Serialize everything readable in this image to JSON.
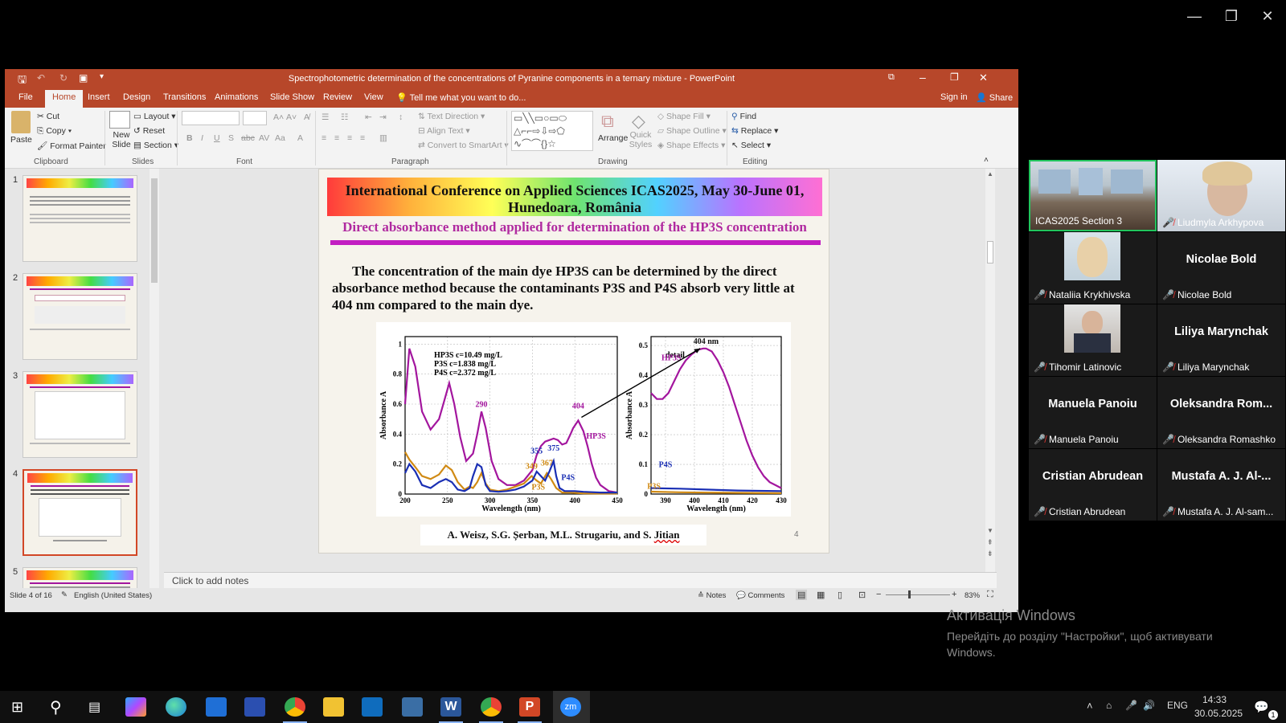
{
  "outer": {
    "minimize": "—",
    "restore": "❐",
    "close": "✕"
  },
  "ppt": {
    "title": "Spectrophotometric determination of the concentrations of Pyranine components in a ternary mixture - PowerPoint",
    "tabs": [
      "File",
      "Home",
      "Insert",
      "Design",
      "Transitions",
      "Animations",
      "Slide Show",
      "Review",
      "View"
    ],
    "tell_me": "Tell me what you want to do...",
    "sign_in": "Sign in",
    "share": "Share",
    "ribbon": {
      "paste": "Paste",
      "cut": "Cut",
      "copy": "Copy",
      "format_painter": "Format Painter",
      "clipboard": "Clipboard",
      "new_slide": "New Slide",
      "layout": "Layout",
      "reset": "Reset",
      "section": "Section",
      "slides": "Slides",
      "font": "Font",
      "paragraph": "Paragraph",
      "text_direction": "Text Direction",
      "align_text": "Align Text",
      "convert_smartart": "Convert to SmartArt",
      "arrange": "Arrange",
      "quick_styles": "Quick Styles",
      "shape_fill": "Shape Fill",
      "shape_outline": "Shape Outline",
      "shape_effects": "Shape Effects",
      "drawing": "Drawing",
      "find": "Find",
      "replace": "Replace",
      "select": "Select",
      "editing": "Editing"
    },
    "thumb_numbers": [
      "1",
      "2",
      "3",
      "4",
      "5"
    ],
    "slide": {
      "header": "International Conference on Applied Sciences ICAS2025, May 30-June 01, Hunedoara, România",
      "subtitle": "Direct absorbance method applied for determination of the HP3S concentration",
      "body": "The concentration of the main dye HP3S can be determined by the direct absorbance method because the contaminants P3S and P4S absorb very little at 404 nm compared to the main dye.",
      "authors": "A. Weisz, S.G. Șerban, M.L. Strugariu, and S. ",
      "authors_last": "Jitian",
      "number": "4"
    },
    "notes_placeholder": "Click to add notes",
    "status": {
      "slide": "Slide 4 of 16",
      "language": "English (United States)",
      "notes": "Notes",
      "comments": "Comments",
      "zoom": "83%"
    }
  },
  "chart_data": [
    {
      "type": "line",
      "xlabel": "Wavelength (nm)",
      "ylabel": "Absorbance A",
      "xlim": [
        200,
        450
      ],
      "ylim": [
        0,
        1.05
      ],
      "xticks": [
        "200",
        "250",
        "300",
        "350",
        "400",
        "450"
      ],
      "yticks": [
        "0",
        "0.2",
        "0.4",
        "0.6",
        "0.8",
        "1"
      ],
      "legend": [
        "HP3S c=10.49 mg/L",
        "P3S    c=1.838 mg/L",
        "P4S    c=2.372 mg/L"
      ],
      "annotations": [
        "290",
        "355",
        "375",
        "404",
        "349",
        "367",
        "HP3S",
        "P3S",
        "P4S"
      ],
      "series": [
        {
          "name": "HP3S",
          "color": "#a3169e",
          "x": [
            200,
            205,
            212,
            220,
            230,
            240,
            246,
            252,
            258,
            265,
            272,
            280,
            285,
            290,
            295,
            302,
            310,
            320,
            330,
            340,
            350,
            355,
            360,
            365,
            370,
            375,
            380,
            385,
            390,
            395,
            398,
            404,
            410,
            415,
            420,
            425,
            430,
            440,
            450
          ],
          "y": [
            0.6,
            0.97,
            0.85,
            0.55,
            0.43,
            0.5,
            0.62,
            0.74,
            0.6,
            0.38,
            0.22,
            0.27,
            0.4,
            0.55,
            0.44,
            0.22,
            0.1,
            0.06,
            0.06,
            0.09,
            0.16,
            0.26,
            0.32,
            0.35,
            0.36,
            0.37,
            0.36,
            0.33,
            0.34,
            0.4,
            0.44,
            0.49,
            0.42,
            0.32,
            0.2,
            0.11,
            0.06,
            0.02,
            0.01
          ]
        },
        {
          "name": "P3S",
          "color": "#d08a14",
          "x": [
            200,
            205,
            212,
            220,
            230,
            240,
            248,
            255,
            262,
            270,
            276,
            280,
            285,
            290,
            295,
            300,
            310,
            320,
            330,
            340,
            349,
            355,
            360,
            367,
            372,
            378,
            385,
            395,
            410,
            430,
            450
          ],
          "y": [
            0.28,
            0.23,
            0.18,
            0.12,
            0.1,
            0.13,
            0.19,
            0.16,
            0.08,
            0.03,
            0.05,
            0.04,
            0.08,
            0.14,
            0.07,
            0.03,
            0.02,
            0.03,
            0.05,
            0.07,
            0.12,
            0.09,
            0.07,
            0.14,
            0.1,
            0.04,
            0.01,
            0.01,
            0.005,
            0.003,
            0.003
          ]
        },
        {
          "name": "P4S",
          "color": "#1a2fb4",
          "x": [
            200,
            205,
            212,
            220,
            230,
            240,
            248,
            255,
            262,
            270,
            276,
            280,
            285,
            290,
            295,
            300,
            310,
            320,
            330,
            340,
            350,
            355,
            360,
            365,
            370,
            375,
            378,
            382,
            388,
            395,
            400,
            410,
            430,
            450
          ],
          "y": [
            0.14,
            0.2,
            0.15,
            0.06,
            0.04,
            0.08,
            0.1,
            0.08,
            0.03,
            0.02,
            0.04,
            0.12,
            0.2,
            0.18,
            0.06,
            0.02,
            0.015,
            0.02,
            0.03,
            0.05,
            0.09,
            0.15,
            0.12,
            0.09,
            0.15,
            0.22,
            0.12,
            0.04,
            0.02,
            0.02,
            0.02,
            0.015,
            0.01,
            0.01
          ]
        }
      ]
    },
    {
      "type": "line",
      "title": "detail",
      "xlabel": "Wavelength (nm)",
      "ylabel": "Absorbance A",
      "xlim": [
        385,
        430
      ],
      "ylim": [
        0,
        0.53
      ],
      "xticks": [
        "390",
        "400",
        "410",
        "420",
        "430"
      ],
      "yticks": [
        "0",
        "0.1",
        "0.2",
        "0.3",
        "0.4",
        "0.5"
      ],
      "annotations": [
        "404 nm",
        "HP3S",
        "P4S",
        "P3S"
      ],
      "series": [
        {
          "name": "HP3S",
          "color": "#a3169e",
          "x": [
            385,
            387,
            389,
            391,
            393,
            395,
            397,
            399,
            401,
            403,
            404,
            406,
            408,
            410,
            412,
            414,
            416,
            418,
            420,
            422,
            424,
            426,
            428,
            430
          ],
          "y": [
            0.34,
            0.32,
            0.32,
            0.34,
            0.38,
            0.42,
            0.45,
            0.47,
            0.485,
            0.49,
            0.49,
            0.48,
            0.45,
            0.41,
            0.36,
            0.3,
            0.24,
            0.18,
            0.13,
            0.09,
            0.06,
            0.04,
            0.03,
            0.02
          ]
        },
        {
          "name": "P4S",
          "color": "#1a2fb4",
          "x": [
            385,
            395,
            405,
            415,
            430
          ],
          "y": [
            0.02,
            0.018,
            0.015,
            0.012,
            0.01
          ]
        },
        {
          "name": "P3S",
          "color": "#d08a14",
          "x": [
            385,
            395,
            405,
            415,
            430
          ],
          "y": [
            0.008,
            0.006,
            0.005,
            0.004,
            0.003
          ]
        }
      ]
    }
  ],
  "zoom": {
    "tiles": [
      {
        "name": "ICAS2025 Section 3",
        "muted": false,
        "video": true,
        "active": true
      },
      {
        "name": "Liudmyla Arkhypova",
        "muted": true,
        "video": true
      },
      {
        "name": "Nataliia Krykhivska",
        "muted": true,
        "video": true
      },
      {
        "name": "Nicolae Bold",
        "big": "Nicolae Bold",
        "muted": true
      },
      {
        "name": "Tihomir Latinovic",
        "muted": true,
        "video": true
      },
      {
        "name": "Liliya Marynchak",
        "big": "Liliya Marynchak",
        "muted": true
      },
      {
        "name": "Manuela Panoiu",
        "big": "Manuela Panoiu",
        "muted": true
      },
      {
        "name": "Oleksandra Romashko",
        "big": "Oleksandra  Rom...",
        "muted": true
      },
      {
        "name": "Cristian Abrudean",
        "big": "Cristian Abrudean",
        "muted": true
      },
      {
        "name": "Mustafa A. J. Al-sam...",
        "big": "Mustafa A. J. Al-...",
        "muted": true
      }
    ]
  },
  "activation": {
    "title": "Активація Windows",
    "text": "Перейдіть до розділу \"Настройки\", щоб активувати Windows."
  },
  "taskbar": {
    "time": "14:33",
    "date": "30.05.2025",
    "lang": "ENG",
    "notif": "1"
  }
}
